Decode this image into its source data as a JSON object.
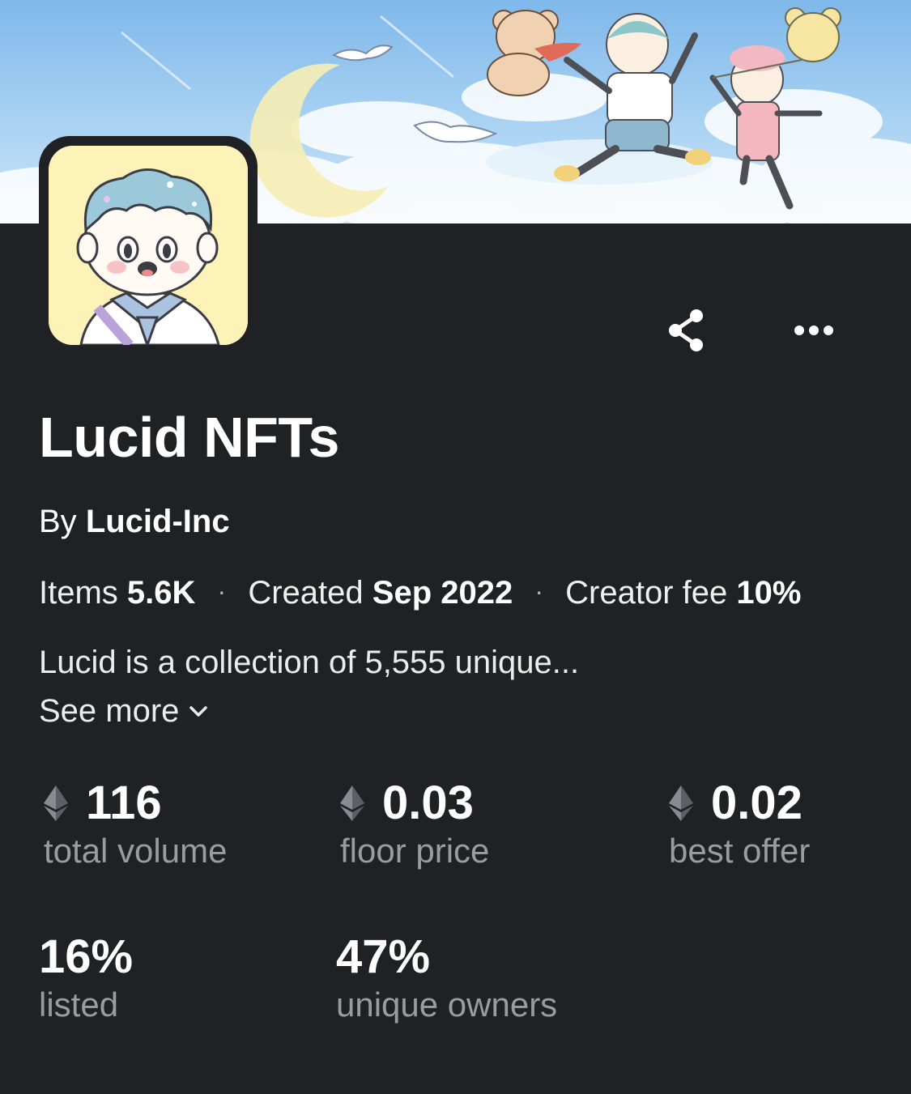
{
  "collection": {
    "name": "Lucid NFTs",
    "by_prefix": "By",
    "creator": "Lucid-Inc"
  },
  "meta": {
    "items_label": "Items",
    "items_value": "5.6K",
    "created_label": "Created",
    "created_value": "Sep 2022",
    "fee_label": "Creator fee",
    "fee_value": "10%",
    "separator": "·"
  },
  "description": {
    "text": "Lucid is a collection of 5,555 unique...",
    "see_more": "See more"
  },
  "stats": [
    {
      "value": "116",
      "label": "total volume",
      "currency_icon": "ethereum-icon"
    },
    {
      "value": "0.03",
      "label": "floor price",
      "currency_icon": "ethereum-icon"
    },
    {
      "value": "0.02",
      "label": "best offer",
      "currency_icon": "ethereum-icon"
    },
    {
      "value": "16%",
      "label": "listed"
    },
    {
      "value": "47%",
      "label": "unique owners"
    }
  ],
  "actions": {
    "share_icon": "share-icon",
    "more_icon": "more-options-icon"
  },
  "colors": {
    "background": "#202125",
    "muted_text": "#9b9ca2",
    "avatar_bg": "#fdf2b7"
  }
}
